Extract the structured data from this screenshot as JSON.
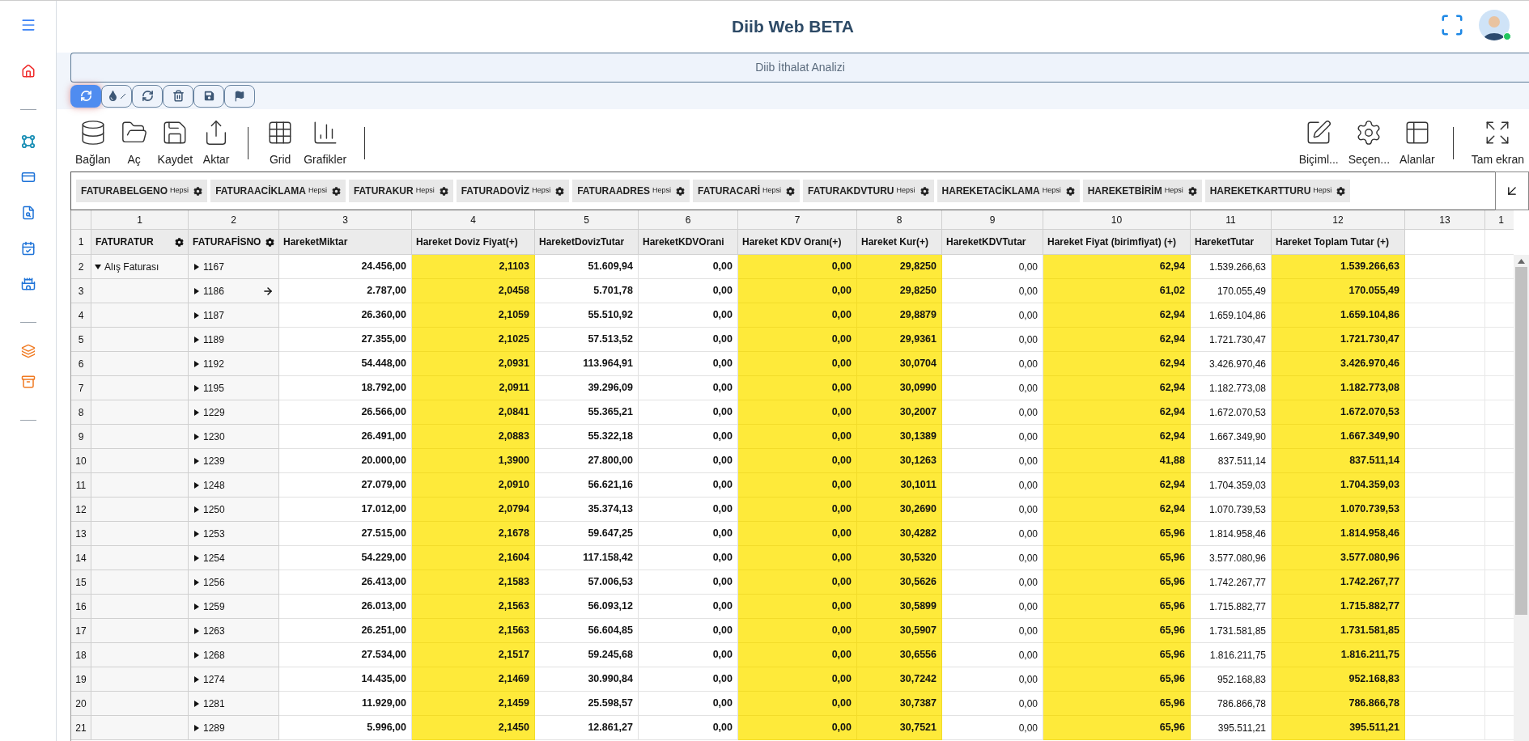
{
  "header": {
    "title": "Diib Web BETA"
  },
  "sidebar": {
    "items": [
      {
        "kind": "menu"
      },
      {
        "kind": "home"
      },
      {
        "kind": "divider"
      },
      {
        "kind": "nodes"
      },
      {
        "kind": "card"
      },
      {
        "kind": "search-doc"
      },
      {
        "kind": "calendar"
      },
      {
        "kind": "castle"
      },
      {
        "kind": "divider"
      },
      {
        "kind": "layers"
      },
      {
        "kind": "archive"
      },
      {
        "kind": "divider"
      }
    ]
  },
  "panel": {
    "title": "Diib İthalat Analizi"
  },
  "action_buttons": [
    {
      "kind": "refresh",
      "selected": true
    },
    {
      "kind": "drop",
      "selected": false
    },
    {
      "kind": "refresh",
      "selected": false
    },
    {
      "kind": "trash",
      "selected": false
    },
    {
      "kind": "save",
      "selected": false
    },
    {
      "kind": "flag",
      "selected": false
    }
  ],
  "toolbar": {
    "left": [
      {
        "kind": "database",
        "label": "Bağlan"
      },
      {
        "kind": "folder",
        "label": "Aç"
      },
      {
        "kind": "save",
        "label": "Kaydet"
      },
      {
        "kind": "export",
        "label": "Aktar"
      },
      {
        "kind": "separator"
      },
      {
        "kind": "grid",
        "label": "Grid"
      },
      {
        "kind": "chart",
        "label": "Grafikler"
      },
      {
        "kind": "separator"
      }
    ],
    "right": [
      {
        "kind": "format",
        "label": "Biçiml..."
      },
      {
        "kind": "settings",
        "label": "Seçen..."
      },
      {
        "kind": "fields",
        "label": "Alanlar"
      },
      {
        "kind": "separator"
      },
      {
        "kind": "fullscreen",
        "label": "Tam ekran"
      }
    ]
  },
  "filters": [
    {
      "label": "FATURABELGENO",
      "value": "Hepsi"
    },
    {
      "label": "FATURAACİKLAMA",
      "value": "Hepsi"
    },
    {
      "label": "FATURAKUR",
      "value": "Hepsi"
    },
    {
      "label": "FATURADOVİZ",
      "value": "Hepsi"
    },
    {
      "label": "FATURAADRES",
      "value": "Hepsi"
    },
    {
      "label": "FATURACARİ",
      "value": "Hepsi"
    },
    {
      "label": "FATURAKDVTURU",
      "value": "Hepsi"
    },
    {
      "label": "HAREKETACİKLAMA",
      "value": "Hepsi"
    },
    {
      "label": "HAREKETBİRİM",
      "value": "Hepsi"
    },
    {
      "label": "HAREKETKARTTURU",
      "value": "Hepsi"
    }
  ],
  "table": {
    "header_row_number": "1",
    "columns": [
      {
        "number": "1",
        "kind": "dimension",
        "label": "FATURATUR"
      },
      {
        "number": "2",
        "kind": "dimension",
        "label": "FATURAFİSNO"
      },
      {
        "number": "3",
        "kind": "measure",
        "label": "HareketMiktar",
        "highlighted": false,
        "bold": true
      },
      {
        "number": "4",
        "kind": "measure",
        "label": "Hareket Doviz Fiyat(+)",
        "highlighted": true,
        "bold": true
      },
      {
        "number": "5",
        "kind": "measure",
        "label": "HareketDovizTutar",
        "highlighted": false,
        "bold": true
      },
      {
        "number": "6",
        "kind": "measure",
        "label": "HareketKDVOrani",
        "highlighted": false,
        "bold": true
      },
      {
        "number": "7",
        "kind": "measure",
        "label": "Hareket KDV Oranı(+)",
        "highlighted": true,
        "bold": true
      },
      {
        "number": "8",
        "kind": "measure",
        "label": "Hareket Kur(+)",
        "highlighted": true,
        "bold": true
      },
      {
        "number": "9",
        "kind": "measure",
        "label": "HareketKDVTutar",
        "highlighted": false,
        "bold": false
      },
      {
        "number": "10",
        "kind": "measure",
        "label": "Hareket Fiyat (birimfiyat) (+)",
        "highlighted": true,
        "bold": true
      },
      {
        "number": "11",
        "kind": "measure",
        "label": "HareketTutar",
        "highlighted": false,
        "bold": false
      },
      {
        "number": "12",
        "kind": "measure",
        "label": "Hareket Toplam Tutar (+)",
        "highlighted": true,
        "bold": true
      },
      {
        "number": "13",
        "kind": "empty"
      },
      {
        "number": "1",
        "kind": "empty"
      }
    ],
    "rows": [
      {
        "n": "2",
        "group": {
          "label": "Alış Faturası",
          "expanded": true
        },
        "fisno": "1167",
        "expanded": false,
        "hovered": false,
        "values": [
          "24.456,00",
          "2,1103",
          "51.609,94",
          "0,00",
          "0,00",
          "29,8250",
          "0,00",
          "62,94",
          "1.539.266,63",
          "1.539.266,63"
        ]
      },
      {
        "n": "3",
        "fisno": "1186",
        "expanded": false,
        "hovered": true,
        "values": [
          "2.787,00",
          "2,0458",
          "5.701,78",
          "0,00",
          "0,00",
          "29,8250",
          "0,00",
          "61,02",
          "170.055,49",
          "170.055,49"
        ]
      },
      {
        "n": "4",
        "fisno": "1187",
        "expanded": false,
        "hovered": false,
        "values": [
          "26.360,00",
          "2,1059",
          "55.510,92",
          "0,00",
          "0,00",
          "29,8879",
          "0,00",
          "62,94",
          "1.659.104,86",
          "1.659.104,86"
        ]
      },
      {
        "n": "5",
        "fisno": "1189",
        "expanded": false,
        "hovered": false,
        "values": [
          "27.355,00",
          "2,1025",
          "57.513,52",
          "0,00",
          "0,00",
          "29,9361",
          "0,00",
          "62,94",
          "1.721.730,47",
          "1.721.730,47"
        ]
      },
      {
        "n": "6",
        "fisno": "1192",
        "expanded": false,
        "hovered": false,
        "values": [
          "54.448,00",
          "2,0931",
          "113.964,91",
          "0,00",
          "0,00",
          "30,0704",
          "0,00",
          "62,94",
          "3.426.970,46",
          "3.426.970,46"
        ]
      },
      {
        "n": "7",
        "fisno": "1195",
        "expanded": false,
        "hovered": false,
        "values": [
          "18.792,00",
          "2,0911",
          "39.296,09",
          "0,00",
          "0,00",
          "30,0990",
          "0,00",
          "62,94",
          "1.182.773,08",
          "1.182.773,08"
        ]
      },
      {
        "n": "8",
        "fisno": "1229",
        "expanded": false,
        "hovered": false,
        "values": [
          "26.566,00",
          "2,0841",
          "55.365,21",
          "0,00",
          "0,00",
          "30,2007",
          "0,00",
          "62,94",
          "1.672.070,53",
          "1.672.070,53"
        ]
      },
      {
        "n": "9",
        "fisno": "1230",
        "expanded": false,
        "hovered": false,
        "values": [
          "26.491,00",
          "2,0883",
          "55.322,18",
          "0,00",
          "0,00",
          "30,1389",
          "0,00",
          "62,94",
          "1.667.349,90",
          "1.667.349,90"
        ]
      },
      {
        "n": "10",
        "fisno": "1239",
        "expanded": false,
        "hovered": false,
        "values": [
          "20.000,00",
          "1,3900",
          "27.800,00",
          "0,00",
          "0,00",
          "30,1263",
          "0,00",
          "41,88",
          "837.511,14",
          "837.511,14"
        ]
      },
      {
        "n": "11",
        "fisno": "1248",
        "expanded": false,
        "hovered": false,
        "values": [
          "27.079,00",
          "2,0910",
          "56.621,16",
          "0,00",
          "0,00",
          "30,1011",
          "0,00",
          "62,94",
          "1.704.359,03",
          "1.704.359,03"
        ]
      },
      {
        "n": "12",
        "fisno": "1250",
        "expanded": false,
        "hovered": false,
        "values": [
          "17.012,00",
          "2,0794",
          "35.374,13",
          "0,00",
          "0,00",
          "30,2690",
          "0,00",
          "62,94",
          "1.070.739,53",
          "1.070.739,53"
        ]
      },
      {
        "n": "13",
        "fisno": "1253",
        "expanded": false,
        "hovered": false,
        "values": [
          "27.515,00",
          "2,1678",
          "59.647,25",
          "0,00",
          "0,00",
          "30,4282",
          "0,00",
          "65,96",
          "1.814.958,46",
          "1.814.958,46"
        ]
      },
      {
        "n": "14",
        "fisno": "1254",
        "expanded": false,
        "hovered": false,
        "values": [
          "54.229,00",
          "2,1604",
          "117.158,42",
          "0,00",
          "0,00",
          "30,5320",
          "0,00",
          "65,96",
          "3.577.080,96",
          "3.577.080,96"
        ]
      },
      {
        "n": "15",
        "fisno": "1256",
        "expanded": false,
        "hovered": false,
        "values": [
          "26.413,00",
          "2,1583",
          "57.006,53",
          "0,00",
          "0,00",
          "30,5626",
          "0,00",
          "65,96",
          "1.742.267,77",
          "1.742.267,77"
        ]
      },
      {
        "n": "16",
        "fisno": "1259",
        "expanded": false,
        "hovered": false,
        "values": [
          "26.013,00",
          "2,1563",
          "56.093,12",
          "0,00",
          "0,00",
          "30,5899",
          "0,00",
          "65,96",
          "1.715.882,77",
          "1.715.882,77"
        ]
      },
      {
        "n": "17",
        "fisno": "1263",
        "expanded": false,
        "hovered": false,
        "values": [
          "26.251,00",
          "2,1563",
          "56.604,85",
          "0,00",
          "0,00",
          "30,5907",
          "0,00",
          "65,96",
          "1.731.581,85",
          "1.731.581,85"
        ]
      },
      {
        "n": "18",
        "fisno": "1268",
        "expanded": false,
        "hovered": false,
        "values": [
          "27.534,00",
          "2,1517",
          "59.245,68",
          "0,00",
          "0,00",
          "30,6556",
          "0,00",
          "65,96",
          "1.816.211,75",
          "1.816.211,75"
        ]
      },
      {
        "n": "19",
        "fisno": "1274",
        "expanded": false,
        "hovered": false,
        "values": [
          "14.435,00",
          "2,1469",
          "30.990,84",
          "0,00",
          "0,00",
          "30,7242",
          "0,00",
          "65,96",
          "952.168,83",
          "952.168,83"
        ]
      },
      {
        "n": "20",
        "fisno": "1281",
        "expanded": false,
        "hovered": false,
        "values": [
          "11.929,00",
          "2,1459",
          "25.598,57",
          "0,00",
          "0,00",
          "30,7387",
          "0,00",
          "65,96",
          "786.866,78",
          "786.866,78"
        ]
      },
      {
        "n": "21",
        "fisno": "1289",
        "expanded": false,
        "hovered": false,
        "values": [
          "5.996,00",
          "2,1450",
          "12.861,27",
          "0,00",
          "0,00",
          "30,7521",
          "0,00",
          "65,96",
          "395.511,21",
          "395.511,21"
        ]
      }
    ]
  }
}
